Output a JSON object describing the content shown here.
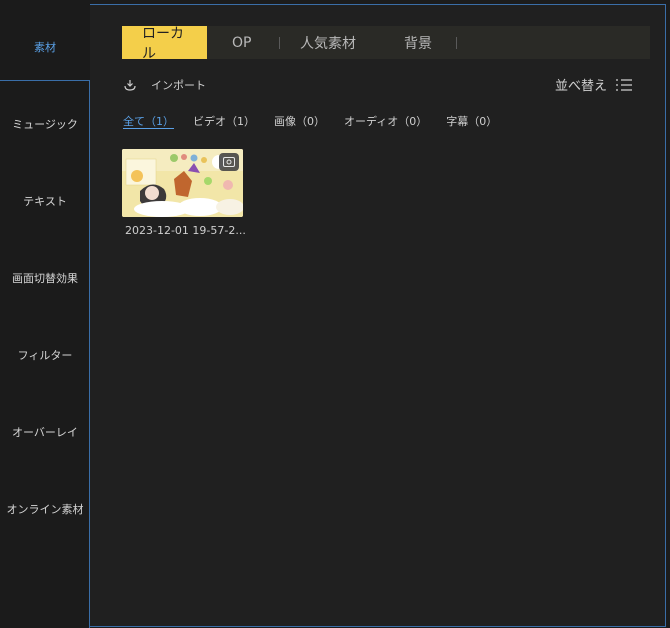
{
  "sidebar": {
    "items": [
      {
        "label": "素材",
        "active": true
      },
      {
        "label": "ミュージック"
      },
      {
        "label": "テキスト"
      },
      {
        "label": "画面切替効果"
      },
      {
        "label": "フィルター"
      },
      {
        "label": "オーバーレイ"
      },
      {
        "label": "オンライン素材"
      }
    ]
  },
  "tabs": [
    {
      "label": "ローカル",
      "active": true
    },
    {
      "label": "OP"
    },
    {
      "label": "人気素材"
    },
    {
      "label": "背景"
    }
  ],
  "toolbar": {
    "import_label": "インポート",
    "sort_label": "並べ替え",
    "import_icon": "import-icon",
    "sort_icon": "sort-list-icon"
  },
  "filters": [
    {
      "label": "全て（1）",
      "active": true
    },
    {
      "label": "ビデオ（1）"
    },
    {
      "label": "画像（0）"
    },
    {
      "label": "オーディオ（0）"
    },
    {
      "label": "字幕（0）"
    }
  ],
  "media": [
    {
      "caption": "2023-12-01 19-57-2...",
      "badge_icon": "video-badge-icon"
    }
  ],
  "colors": {
    "accent": "#f4cf4a",
    "link": "#5aa0e6",
    "border": "#3a6ea8"
  }
}
